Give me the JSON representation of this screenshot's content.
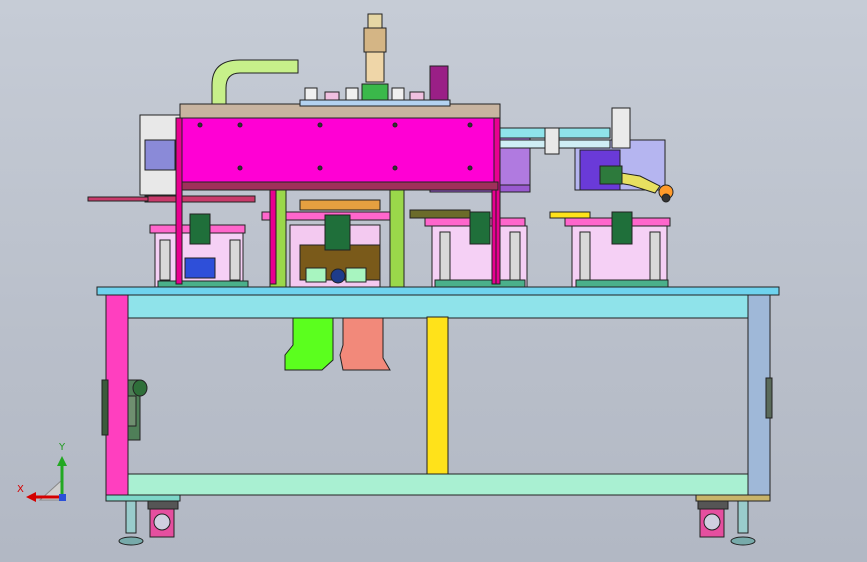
{
  "scene": {
    "background": "#bcc2cc",
    "colors": {
      "frame_cyan": "#8fe3ea",
      "frame_mint": "#a9f0d2",
      "magenta": "#ff00d4",
      "table_top": "#6fd3ee",
      "pink": "#ff4fb0",
      "yellow": "#ffe000",
      "green": "#5bff1e",
      "salmon": "#f2897a",
      "steel_blue": "#9fb8d8",
      "purple": "#9a1f86",
      "lime": "#c7f08a"
    }
  },
  "triad": {
    "x_label": "X",
    "y_label": "Y",
    "x_color": "#d40000",
    "y_color": "#22a822",
    "z_color": "#2a4fd8"
  }
}
